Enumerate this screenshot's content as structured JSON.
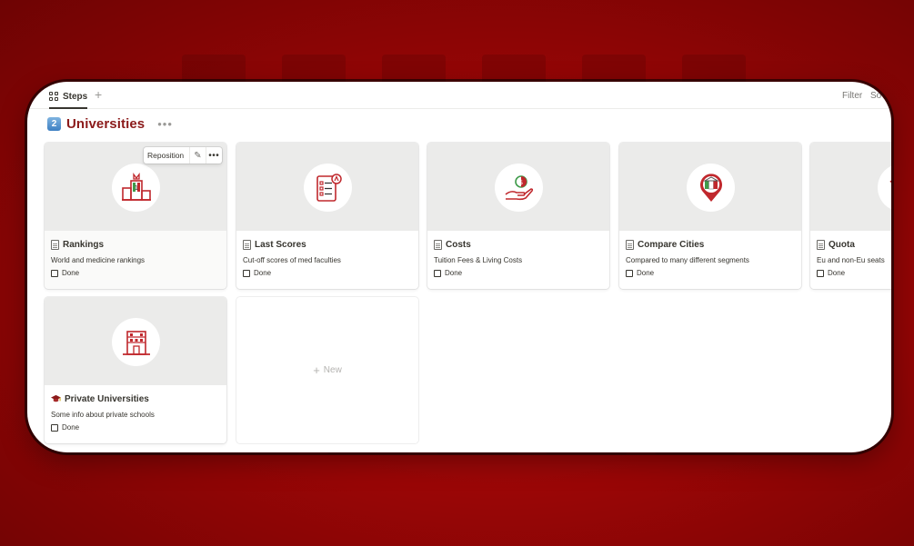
{
  "view": {
    "tab_label": "Steps",
    "add_view_label": "+",
    "filter_label": "Filter",
    "sort_label": "So"
  },
  "page": {
    "number_badge": "2",
    "title": "Universities",
    "more_label": "•••"
  },
  "hover_toolbar": {
    "reposition_label": "Reposition",
    "edit_label": "✎",
    "more_label": "•••"
  },
  "cards": [
    {
      "title": "Rankings",
      "description": "World and medicine rankings",
      "done_label": "Done",
      "icon": "podium-icon",
      "page_icon": "document-icon"
    },
    {
      "title": "Last Scores",
      "description": "Cut-off scores of med faculties",
      "done_label": "Done",
      "icon": "checklist-icon",
      "page_icon": "document-icon"
    },
    {
      "title": "Costs",
      "description": "Tuition Fees & Living Costs",
      "done_label": "Done",
      "icon": "hand-coin-icon",
      "page_icon": "document-icon"
    },
    {
      "title": "Compare Cities",
      "description": "Compared to many different segments",
      "done_label": "Done",
      "icon": "map-pin-icon",
      "page_icon": "document-icon"
    },
    {
      "title": "Quota",
      "description": "Eu and non-Eu seats",
      "done_label": "Done",
      "icon": "building-icon",
      "page_icon": "document-icon"
    },
    {
      "title": "Private Universities",
      "description": "Some info about private schools",
      "done_label": "Done",
      "icon": "school-building-icon",
      "page_icon": "graduation-cap-icon"
    }
  ],
  "new_card": {
    "plus": "+",
    "label": "New"
  },
  "colors": {
    "background": "#a50808",
    "icon_red": "#c0282d",
    "icon_green": "#3f9b4a",
    "title": "#8b1a1a"
  }
}
